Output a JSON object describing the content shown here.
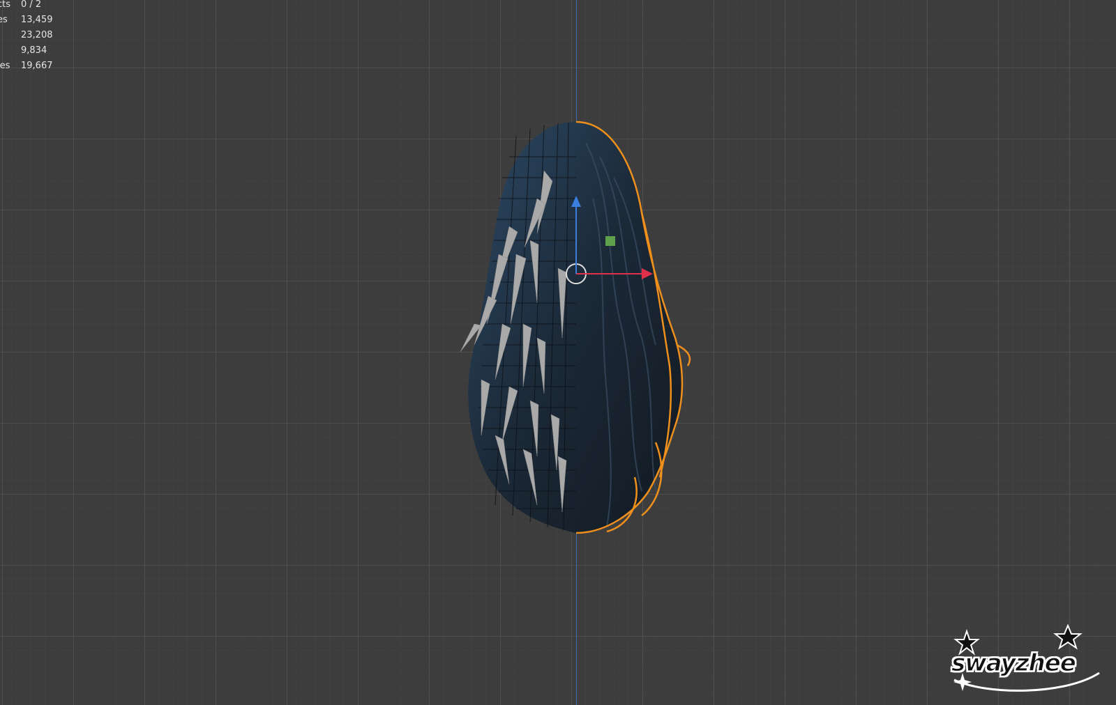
{
  "viewport": {
    "background_color": "#3d3d3d",
    "grid_color": "#5a5a5a",
    "axis_color": "#3b6fb0"
  },
  "statistics": {
    "rows": [
      {
        "label": "cts",
        "value": "0 / 2"
      },
      {
        "label": "es",
        "value": "13,459"
      },
      {
        "label": "",
        "value": "23,208"
      },
      {
        "label": "",
        "value": "9,834"
      },
      {
        "label": "les",
        "value": "19,667"
      }
    ]
  },
  "model": {
    "selection_outline_color": "#f0901c",
    "hair_color": "#1f2d3c",
    "gizmo": {
      "x_axis_color": "#e0304a",
      "y_axis_color": "#5fa04a",
      "z_axis_color": "#3a7fe0"
    }
  },
  "watermark": {
    "text": "swayzhee"
  }
}
